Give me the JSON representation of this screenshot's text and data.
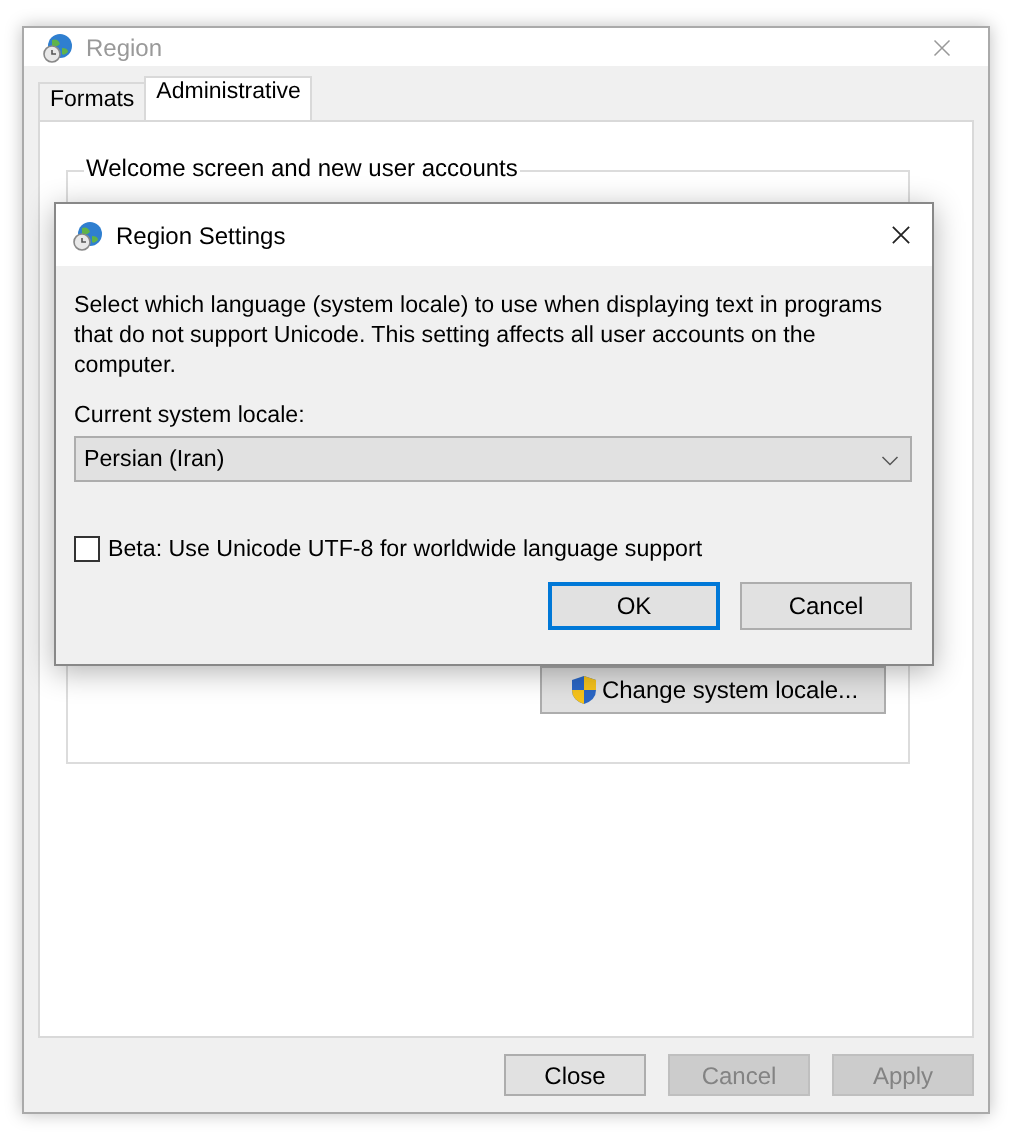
{
  "window": {
    "title": "Region"
  },
  "tabs": [
    {
      "label": "Formats",
      "selected": false
    },
    {
      "label": "Administrative",
      "selected": true
    }
  ],
  "group": {
    "title": "Welcome screen and new user accounts",
    "button": "Change system locale..."
  },
  "buttons": [
    {
      "label": "Close",
      "disabled": false
    },
    {
      "label": "Cancel",
      "disabled": true
    },
    {
      "label": "Apply",
      "disabled": true
    }
  ],
  "dialog": {
    "title": "Region Settings",
    "description": "Select which language (system locale) to use when displaying text in programs that do not support Unicode. This setting affects all user accounts on the computer.",
    "locale_label": "Current system locale:",
    "locale": "Persian (Iran)",
    "beta": {
      "label": "Beta: Use Unicode UTF-8 for worldwide language support",
      "checked": false
    },
    "buttons": [
      {
        "label": "OK",
        "default": true
      },
      {
        "label": "Cancel",
        "default": false
      }
    ]
  }
}
